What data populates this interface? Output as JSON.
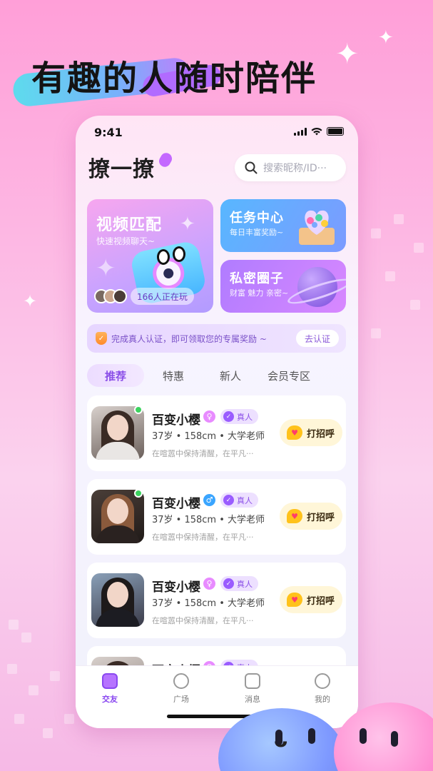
{
  "promo": {
    "headline": "有趣的人随时陪伴"
  },
  "status_bar": {
    "time": "9:41"
  },
  "app": {
    "logo_text": "撩一撩"
  },
  "search": {
    "placeholder": "搜索昵称/ID···"
  },
  "feature_cards": {
    "video_match": {
      "title": "视频匹配",
      "subtitle": "快速视频聊天~",
      "playing_count": "166人正在玩"
    },
    "task_center": {
      "title": "任务中心",
      "subtitle": "每日丰富奖励~"
    },
    "private_circle": {
      "title": "私密圈子",
      "subtitle": "财富 魅力 亲密~"
    }
  },
  "verify_banner": {
    "text": "完成真人认证，即可领取您的专属奖励 ~",
    "button_label": "去认证"
  },
  "tabs": [
    {
      "label": "推荐",
      "active": true
    },
    {
      "label": "特惠",
      "active": false
    },
    {
      "label": "新人",
      "active": false
    },
    {
      "label": "会员专区",
      "active": false
    }
  ],
  "users": [
    {
      "name": "百变小樱",
      "gender": "female",
      "gender_symbol": "♀",
      "gender_color": "#e88bff",
      "online": true,
      "verified_label": "真人",
      "info": "37岁 • 158cm • 大学老师",
      "bio": "在喧嚣中保持清醒，在平凡···",
      "greet_label": "打招呼"
    },
    {
      "name": "百变小樱",
      "gender": "male",
      "gender_symbol": "♂",
      "gender_color": "#3aa5ff",
      "online": true,
      "verified_label": "真人",
      "info": "37岁 • 158cm • 大学老师",
      "bio": "在喧嚣中保持清醒，在平凡···",
      "greet_label": "打招呼"
    },
    {
      "name": "百变小樱",
      "gender": "female",
      "gender_symbol": "♀",
      "gender_color": "#e88bff",
      "online": false,
      "verified_label": "真人",
      "info": "37岁 • 158cm • 大学老师",
      "bio": "在喧嚣中保持清醒，在平凡···",
      "greet_label": "打招呼"
    },
    {
      "name": "百变小樱",
      "gender": "female",
      "gender_symbol": "♀",
      "gender_color": "#e88bff",
      "online": false,
      "verified_label": "真人",
      "info": "",
      "bio": "",
      "greet_label": ""
    }
  ],
  "tabbar": [
    {
      "label": "交友",
      "icon": "friends-icon",
      "active": true
    },
    {
      "label": "广场",
      "icon": "plaza-icon",
      "active": false
    },
    {
      "label": "消息",
      "icon": "message-icon",
      "active": false
    },
    {
      "label": "我的",
      "icon": "profile-icon",
      "active": false
    }
  ],
  "colors": {
    "accent": "#8b4fe8",
    "online": "#3cd35f",
    "greet_bg": "#fff6d8"
  }
}
